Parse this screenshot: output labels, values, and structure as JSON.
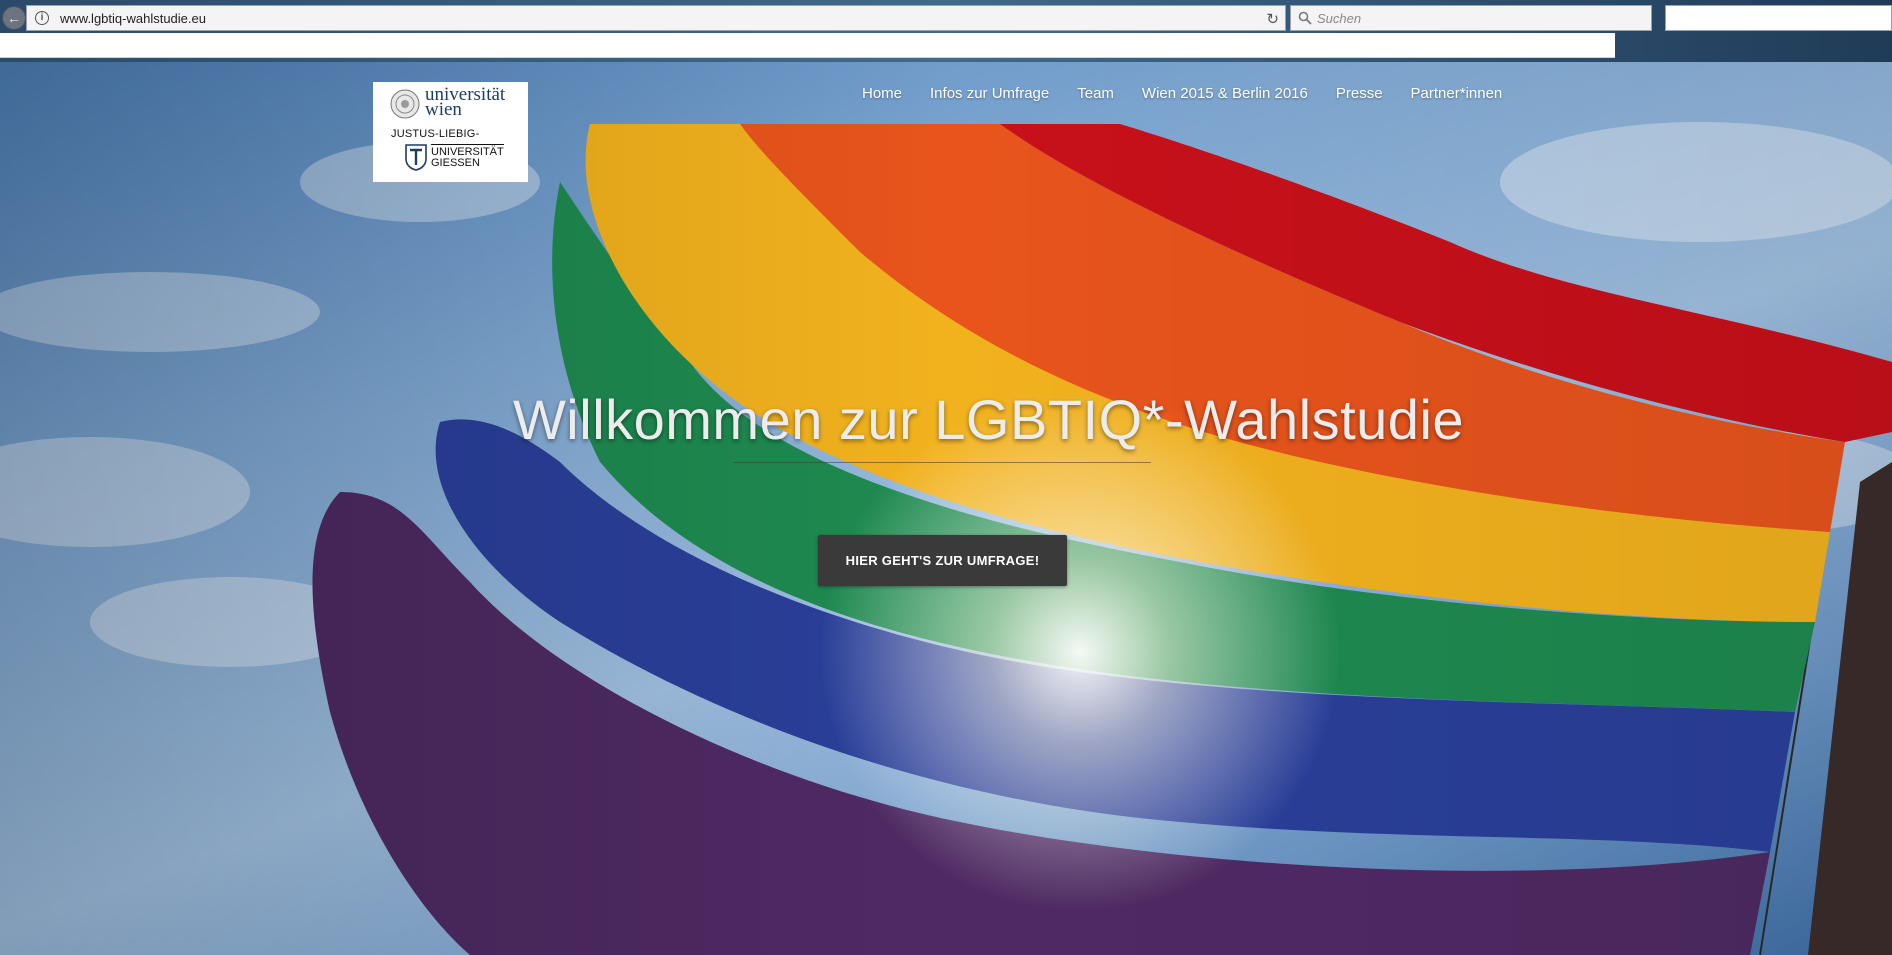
{
  "browser": {
    "back_glyph": "←",
    "url": "www.lgbtiq-wahlstudie.eu",
    "info_glyph": "i",
    "reload_glyph": "↻",
    "search_placeholder": "Suchen",
    "icons": [
      "back-icon",
      "info-icon",
      "reload-icon",
      "search-icon"
    ]
  },
  "logo": {
    "wien_name": "universität wien",
    "jlu_name": "JUSTUS-LIEBIG-",
    "jlu_line1": "UNIVERSITÄT",
    "jlu_line2": "GIESSEN",
    "icons": [
      "university-seal-icon",
      "jlu-mark-icon"
    ]
  },
  "nav": {
    "items": [
      {
        "label": "Home"
      },
      {
        "label": "Infos zur Umfrage"
      },
      {
        "label": "Team"
      },
      {
        "label": "Wien 2015 & Berlin 2016"
      },
      {
        "label": "Presse"
      },
      {
        "label": "Partner*innen"
      }
    ]
  },
  "hero": {
    "title": "Willkommen zur LGBTIQ*-Wahlstudie",
    "cta_label": "HIER GEHT'S ZUR UMFRAGE!",
    "flag_colors": [
      "#c8101a",
      "#e8541c",
      "#f2b21e",
      "#1e8a50",
      "#2a3f9a",
      "#4e2a63"
    ]
  }
}
